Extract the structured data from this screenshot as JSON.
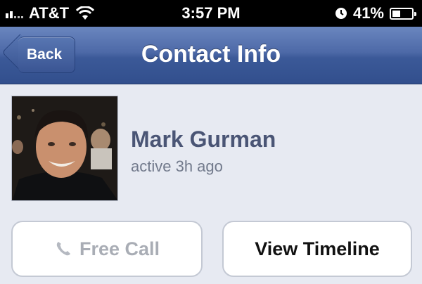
{
  "status_bar": {
    "carrier": "AT&T",
    "time": "3:57 PM",
    "battery_percent": "41%",
    "battery_level": 0.41
  },
  "nav": {
    "back_label": "Back",
    "title": "Contact Info",
    "color": "#3b5998"
  },
  "profile": {
    "name": "Mark Gurman",
    "status": "active 3h ago"
  },
  "actions": {
    "free_call_label": "Free Call",
    "view_timeline_label": "View Timeline"
  }
}
